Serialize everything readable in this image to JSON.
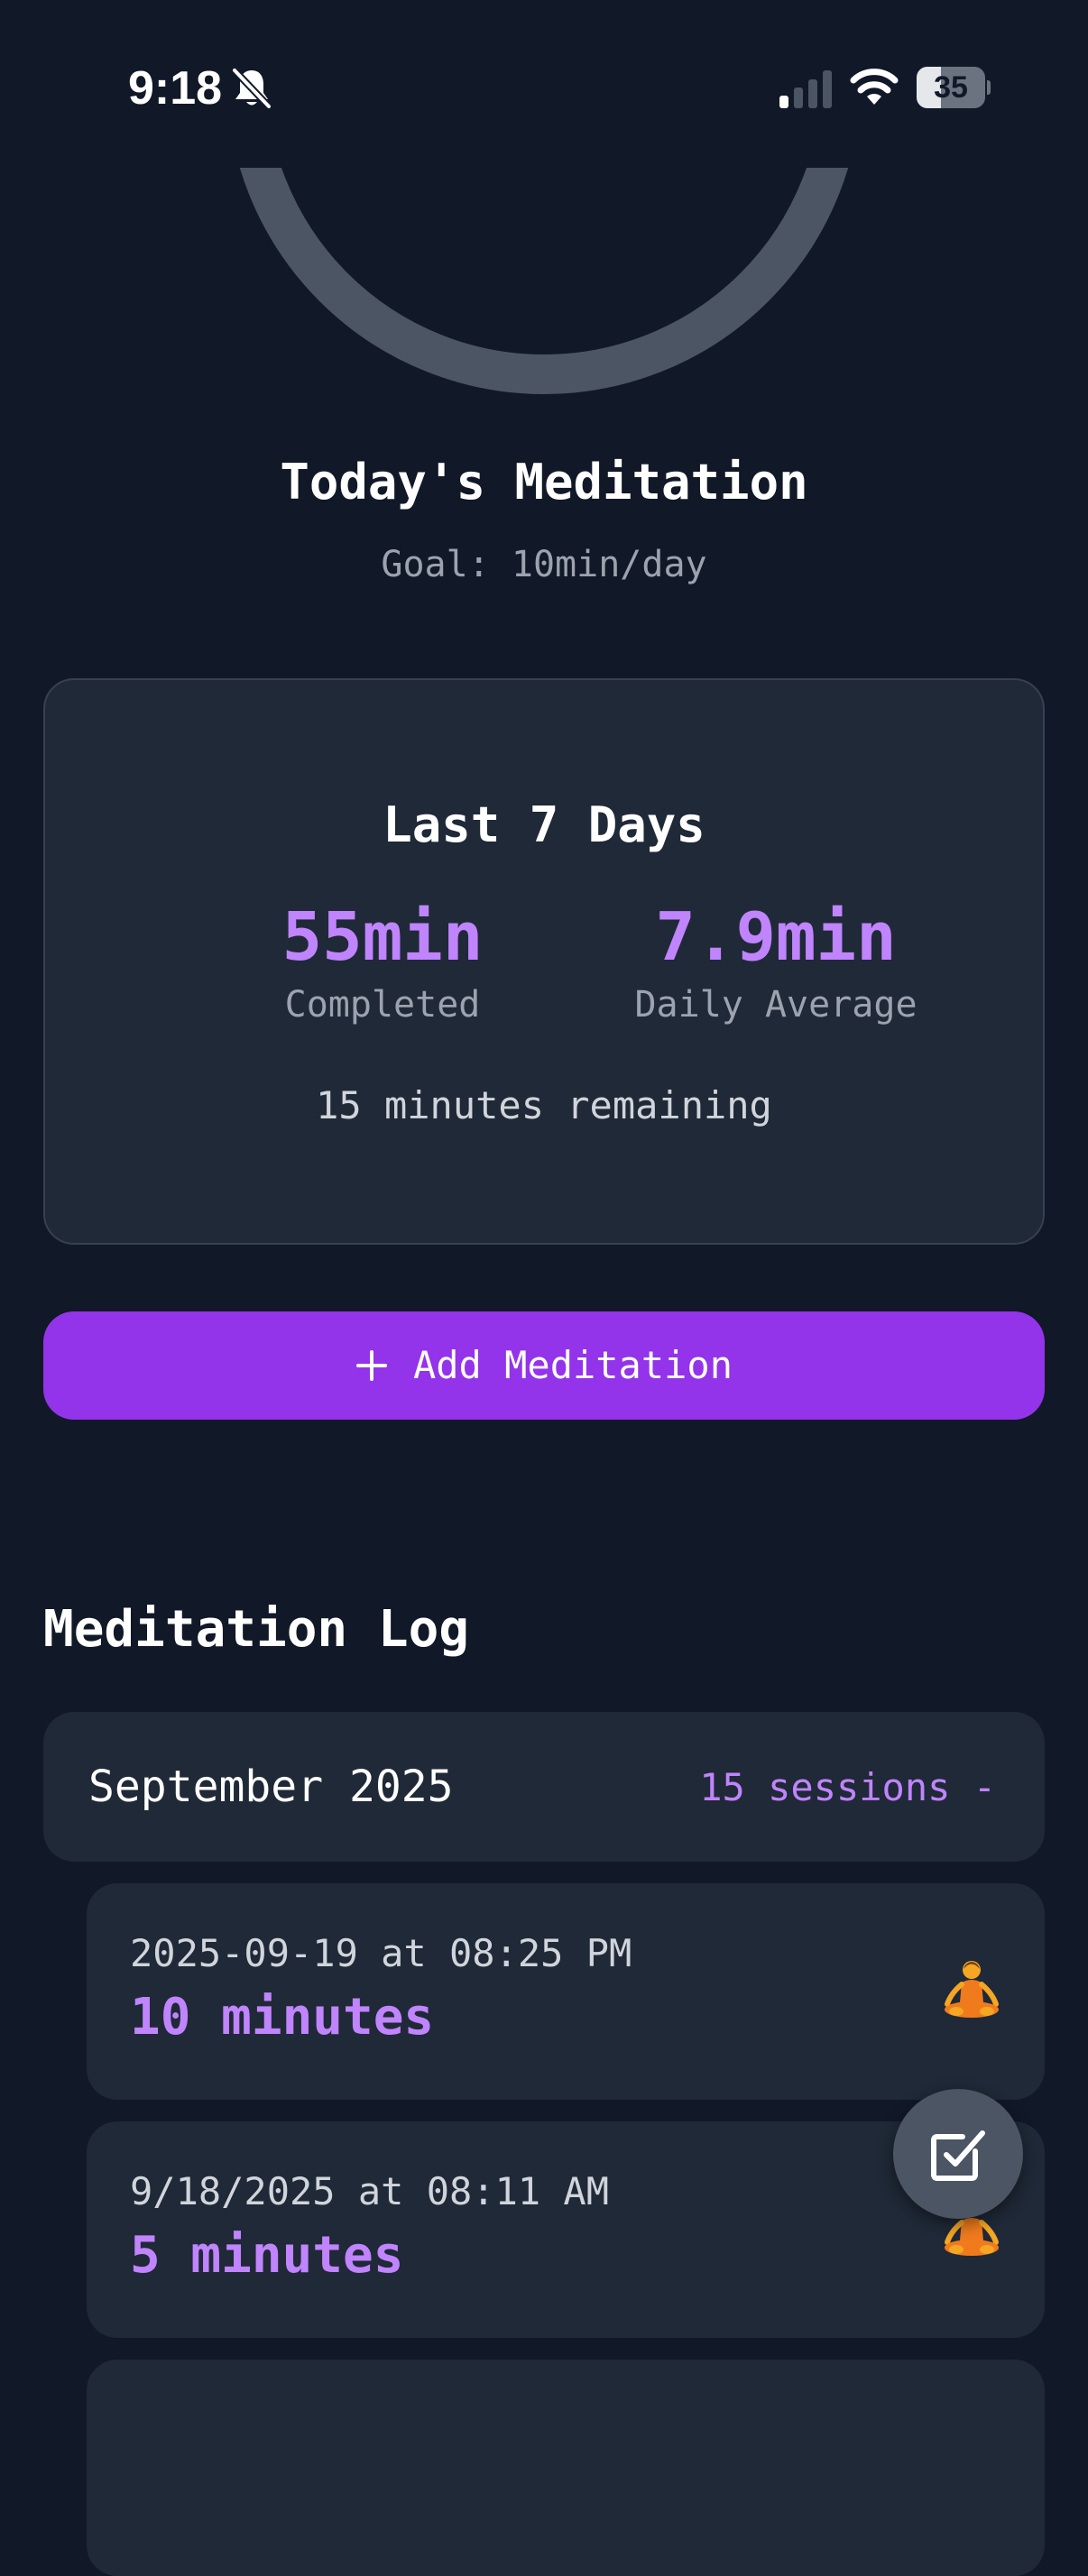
{
  "status_bar": {
    "time": "9:18",
    "battery_level": "35",
    "icons": [
      "bell-slash-icon",
      "cellular-signal-icon",
      "wifi-icon",
      "battery-icon"
    ]
  },
  "progress": {
    "shape": "ring"
  },
  "header": {
    "title": "Today's Meditation",
    "goal": "Goal: 10min/day"
  },
  "stats": {
    "title": "Last 7 Days",
    "completed_value": "55min",
    "completed_label": "Completed",
    "average_value": "7.9min",
    "average_label": "Daily Average",
    "remaining": "15 minutes remaining"
  },
  "actions": {
    "add_label": "Add Meditation",
    "add_icon": "plus-icon",
    "fab_icon": "checkbox-icon"
  },
  "log": {
    "heading": "Meditation Log",
    "month": "September 2025",
    "month_count": "15 sessions -",
    "sessions": [
      {
        "date": "2025-09-19 at 08:25 PM",
        "duration": "10 minutes",
        "icon": "meditation-person-icon"
      },
      {
        "date": "9/18/2025 at 08:11 AM",
        "duration": "5 minutes",
        "icon": "meditation-person-icon"
      }
    ]
  },
  "colors": {
    "background": "#111827",
    "card": "#1f2937",
    "accent": "#9333ea",
    "accent_text": "#c084fc",
    "ring_track": "#4b5563",
    "muted_text": "#9ca3af",
    "fab": "#4b5563"
  }
}
